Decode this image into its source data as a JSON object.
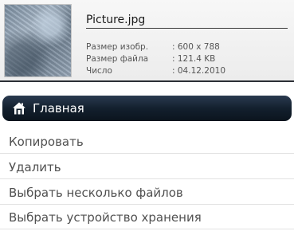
{
  "file_info": {
    "filename": "Picture.jpg",
    "rows": [
      {
        "label": "Размер изобр.",
        "value": ": 600 x 788"
      },
      {
        "label": "Размер файла",
        "value": ": 121.4 KB"
      },
      {
        "label": "Число",
        "value": ": 04.12.2010"
      }
    ]
  },
  "menu": {
    "header": {
      "label": "Главная",
      "icon": "home-icon"
    },
    "items": [
      {
        "label": "Копировать"
      },
      {
        "label": "Удалить"
      },
      {
        "label": "Выбрать несколько файлов"
      },
      {
        "label": "Выбрать устройство хранения"
      }
    ]
  },
  "colors": {
    "header_bg": "#13202e",
    "header_text": "#ffffff",
    "item_text": "#505050"
  }
}
